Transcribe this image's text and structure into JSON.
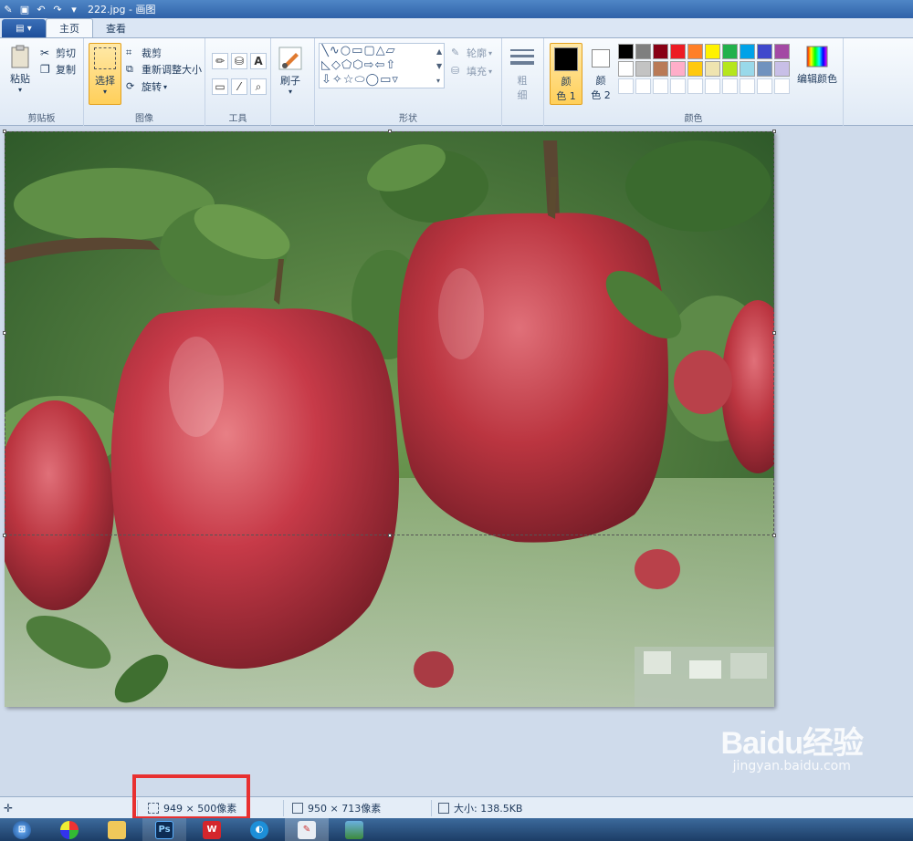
{
  "window": {
    "title": "222.jpg - 画图"
  },
  "tabs": [
    {
      "label": "主页",
      "active": true
    },
    {
      "label": "查看",
      "active": false
    }
  ],
  "clipboard": {
    "paste_label": "粘贴",
    "cut_label": "剪切",
    "copy_label": "复制",
    "group_label": "剪贴板"
  },
  "image": {
    "select_label": "选择",
    "crop_label": "裁剪",
    "resize_label": "重新调整大小",
    "rotate_label": "旋转",
    "group_label": "图像"
  },
  "tools": {
    "group_label": "工具",
    "text_tool": "A"
  },
  "brushes": {
    "label": "刷子"
  },
  "shapes": {
    "outline_label": "轮廓",
    "fill_label": "填充",
    "group_label": "形状",
    "row1": "╲∿○▭▢△▱",
    "row2": "◺◇⬠⬡⇨⇦⇧",
    "row3": "⇩✧☆⬭◯▭▿"
  },
  "size": {
    "label_line1": "粗",
    "label_line2": "细"
  },
  "colors": {
    "color1_line1": "颜",
    "color1_line2": "色 1",
    "color2_line1": "颜",
    "color2_line2": "色 2",
    "edit_label": "编辑颜色",
    "group_label": "颜色",
    "color1": "#000000",
    "color2": "#ffffff",
    "palette": [
      "#000000",
      "#7f7f7f",
      "#880015",
      "#ed1c24",
      "#ff7f27",
      "#fff200",
      "#22b14c",
      "#00a2e8",
      "#3f48cc",
      "#a349a4",
      "#ffffff",
      "#c3c3c3",
      "#b97a57",
      "#ffaec9",
      "#ffc90e",
      "#efe4b0",
      "#b5e61d",
      "#99d9ea",
      "#7092be",
      "#c8bfe7",
      "#ffffff",
      "#ffffff",
      "#ffffff",
      "#ffffff",
      "#ffffff",
      "#ffffff",
      "#ffffff",
      "#ffffff",
      "#ffffff",
      "#ffffff"
    ]
  },
  "status": {
    "selection_size": "949 × 500像素",
    "image_size": "950 × 713像素",
    "file_size": "大小: 138.5KB"
  },
  "watermark": {
    "logo": "Baidu经验",
    "url": "jingyan.baidu.com"
  },
  "taskbar": {
    "ps_label": "Ps"
  }
}
